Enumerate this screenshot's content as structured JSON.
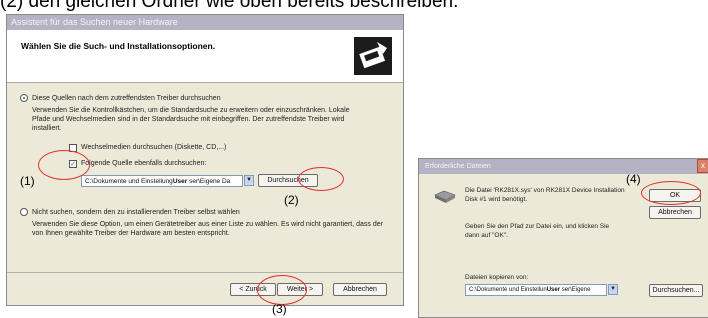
{
  "heading": "(2) den gleichen Ordner wie oben bereits beschreiben.",
  "wizard": {
    "title": "Assistent für das Suchen neuer Hardware",
    "banner_title": "Wählen Sie die Such- und Installationsoptionen.",
    "option_search": "Diese Quellen nach dem zutreffendsten Treiber durchsuchen",
    "search_desc": "Verwenden Sie die Kontrollkästchen, um die Standardsuche zu erweitern oder einzuschränken. Lokale Pfade und Wechselmedien sind in der Standardsuche mit einbegriffen. Der zutreffendste Treiber wird installiert.",
    "removable_label": "Wechselmedien durchsuchen (Diskette, CD,...)",
    "include_label": "Folgende Quelle ebenfalls durchsuchen:",
    "path_prefix": "C:\\Dokumente und Einstellung",
    "path_user": "User",
    "path_suffix": "ser\\Eigene Da",
    "browse_label": "Durchsuchen",
    "option_nosearch": "Nicht suchen, sondern den zu installierenden Treiber selbst wählen",
    "nosearch_desc": "Verwenden Sie diese Option, um einen Gerätetreiber aus einer Liste zu wählen. Es wird nicht garantiert, dass der von Ihnen gewählte Treiber der Hardware am besten entspricht.",
    "back_label": "< Zurück",
    "next_label": "Weiter >",
    "cancel_label": "Abbrechen"
  },
  "dialog": {
    "title": "Erforderliche Dateien",
    "message": "Die Datei 'RK281X.sys' von RK281X Device Installation Disk #1 wird benötigt.",
    "instruction": "Geben Sie den Pfad zur Datei ein, und klicken Sie dann auf \"OK\".",
    "copy_label": "Dateien kopieren von:",
    "path_prefix": "C:\\Dokumente und Einstellun",
    "path_user": "User",
    "path_suffix": "ser\\Eigene",
    "ok_label": "OK",
    "cancel_label": "Abbrechen",
    "browse_label": "Durchsuchen...",
    "close_glyph": "x"
  },
  "annotations": {
    "a1": "(1)",
    "a2": "(2)",
    "a3": "(3)",
    "a4": "(4)"
  },
  "colors": {
    "annotation_ring": "#e23030",
    "title_bar": "#b5b2c4",
    "dialog_face": "#ece9d8"
  }
}
